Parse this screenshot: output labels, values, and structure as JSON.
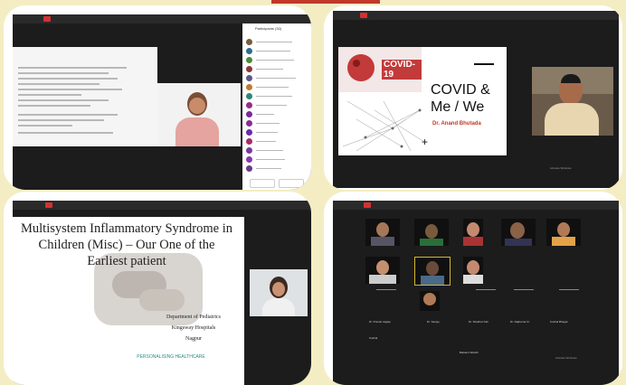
{
  "participants_title": "Participants (30)",
  "covid_slide": {
    "badge": "COVID-19",
    "title": "COVID & Me / We",
    "author": "Dr. Anand Bhutada"
  },
  "misc_slide": {
    "title": "Multisystem Inflammatory Syndrome in Children (Misc) – Our One of the Earliest patient",
    "dept": "Department of Pediatrics",
    "hospital": "Kingsway Hospitals",
    "city": "Nagpur",
    "tagline": "PERSONALISING HEALTHCARE"
  },
  "grid_names": [
    "Dr. Pranali Jagtap",
    "Dr. Sanjay",
    "Dr. Shekhar Kali",
    "Dr. Rajkumar Kr",
    "Kushal Bhagat",
    "Kushal",
    "Balwant Wankh"
  ],
  "watermark": "Activate Windows"
}
